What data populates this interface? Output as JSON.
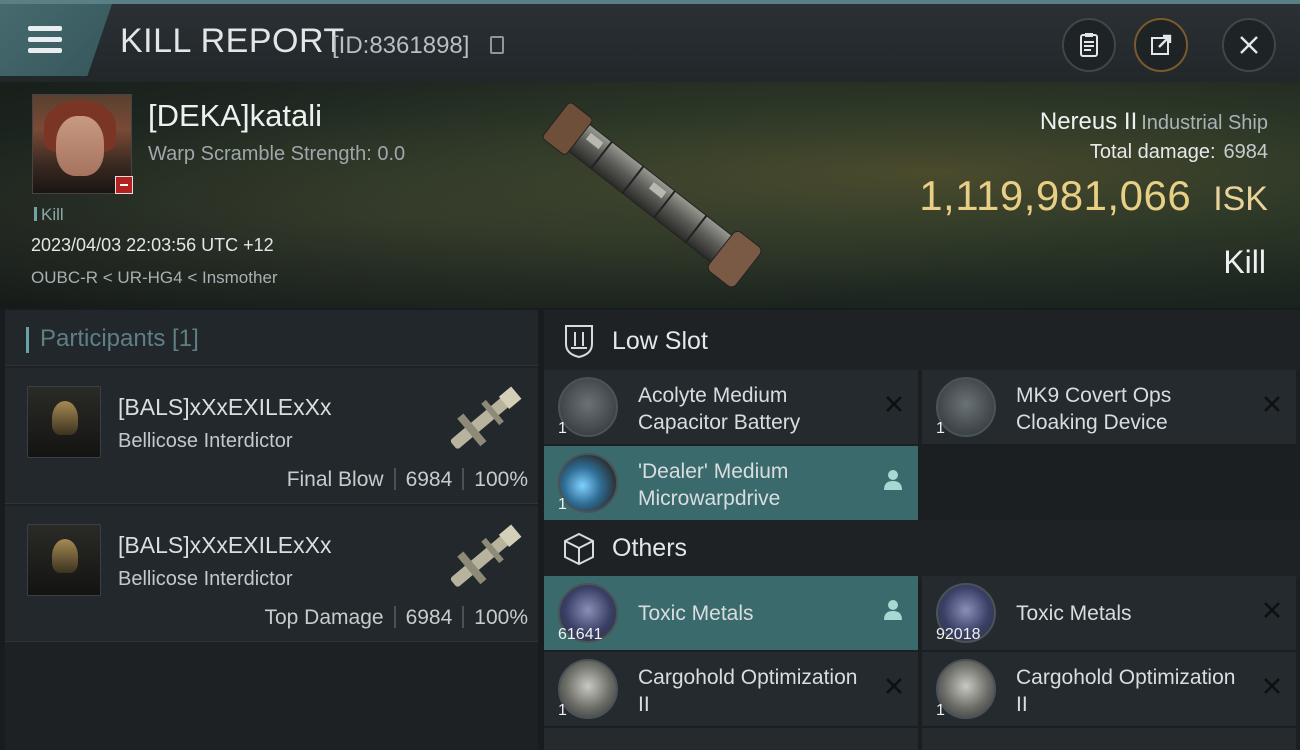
{
  "header": {
    "title": "KILL REPORT",
    "kill_id": "[ID:8361898]"
  },
  "victim": {
    "name": "[DEKA]katali",
    "warp_scramble": "Warp Scramble Strength: 0.0",
    "tag": "Kill",
    "timestamp": "2023/04/03 22:03:56 UTC +12",
    "location": "OUBC-R < UR-HG4 < Insmother"
  },
  "ship": {
    "name": "Nereus II",
    "class": "Industrial Ship",
    "total_damage_label": "Total damage:",
    "total_damage": "6984",
    "isk_value": "1,119,981,066",
    "isk_unit": "ISK",
    "result": "Kill"
  },
  "participants": {
    "title": "Participants [1]",
    "cards": [
      {
        "name": "[BALS]xXxEXILExXx",
        "ship": "Bellicose Interdictor",
        "role": "Final Blow",
        "damage": "6984",
        "percent": "100%"
      },
      {
        "name": "[BALS]xXxEXILExXx",
        "ship": "Bellicose Interdictor",
        "role": "Top Damage",
        "damage": "6984",
        "percent": "100%"
      }
    ]
  },
  "sections": {
    "low_slot": "Low Slot",
    "others": "Others"
  },
  "low_slot_items": [
    {
      "name": "Acolyte Medium Capacitor Battery",
      "qty": "1",
      "highlight": false,
      "icon": "capacitor-battery-icon"
    },
    {
      "name": "MK9 Covert Ops Cloaking Device",
      "qty": "1",
      "highlight": false,
      "icon": "cloaking-device-icon"
    },
    {
      "name": "'Dealer' Medium Microwarpdrive",
      "qty": "1",
      "highlight": true,
      "icon": "microwarpdrive-icon"
    }
  ],
  "other_items": [
    {
      "name": "Toxic Metals",
      "qty": "61641",
      "highlight": true,
      "icon": "toxic-metals-icon"
    },
    {
      "name": "Toxic Metals",
      "qty": "92018",
      "highlight": false,
      "icon": "toxic-metals-icon"
    },
    {
      "name": "Cargohold Optimization II",
      "qty": "1",
      "highlight": false,
      "icon": "cargohold-optimization-icon"
    },
    {
      "name": "Cargohold Optimization II",
      "qty": "1",
      "highlight": false,
      "icon": "cargohold-optimization-icon"
    }
  ],
  "colors": {
    "accent": "#5a7f84",
    "isk": "#e9cf86",
    "highlight_row": "#3b6a6c",
    "badge": "#b52020"
  }
}
